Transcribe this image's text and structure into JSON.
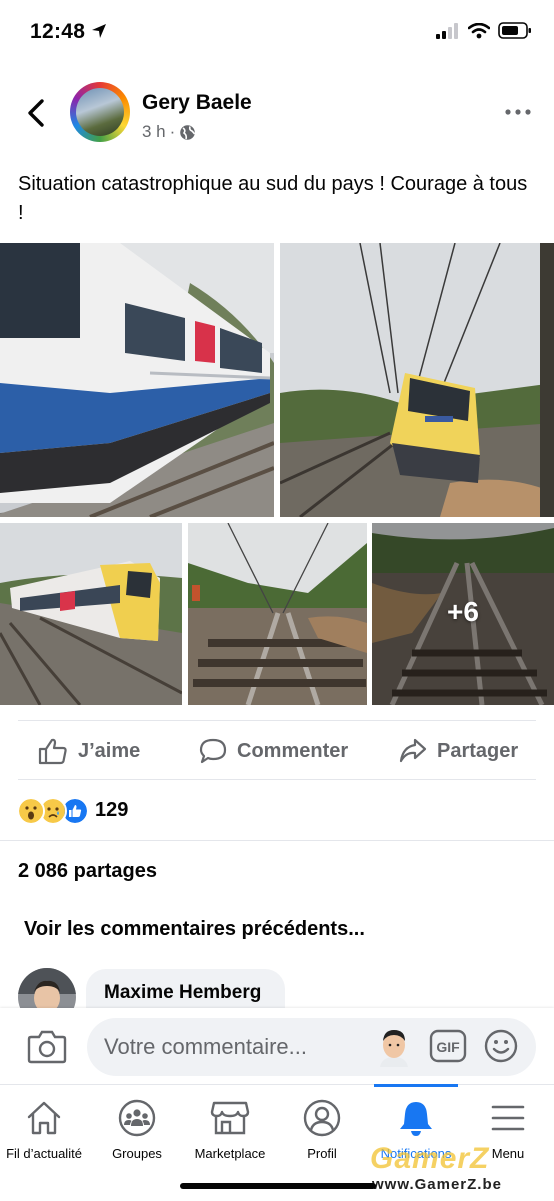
{
  "status_bar": {
    "time": "12:48"
  },
  "post": {
    "author": "Gery Baele",
    "time": "3 h",
    "text": "Situation catastrophique au sud du pays ! Courage à tous !",
    "more_photos": "+6"
  },
  "actions": {
    "like": "J’aime",
    "comment": "Commenter",
    "share": "Partager"
  },
  "reactions": {
    "count": "129",
    "types": [
      "wow",
      "sad",
      "like"
    ]
  },
  "shares": "2 086 partages",
  "previous_comments": "Voir les commentaires précédents...",
  "comment": {
    "author": "Maxime Hemberg"
  },
  "composer": {
    "placeholder": "Votre commentaire..."
  },
  "nav": {
    "items": [
      {
        "label": "Fil d’actualité",
        "icon": "home-icon"
      },
      {
        "label": "Groupes",
        "icon": "groups-icon"
      },
      {
        "label": "Marketplace",
        "icon": "marketplace-icon"
      },
      {
        "label": "Profil",
        "icon": "profile-icon"
      },
      {
        "label": "Notifications",
        "icon": "bell-icon"
      },
      {
        "label": "Menu",
        "icon": "menu-icon"
      }
    ],
    "active": "Notifications"
  },
  "watermark": {
    "logo": "GamerZ",
    "url": "www.GamerZ.be"
  },
  "colors": {
    "accent": "#1877f2",
    "secondary_text": "#65676b",
    "bubble": "#f0f2f5"
  }
}
